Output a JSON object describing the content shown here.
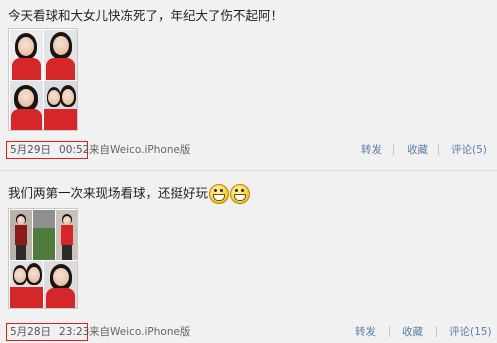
{
  "posts": [
    {
      "text": "今天看球和大女儿快冻死了，年纪大了伤不起阿！",
      "date": "5月29日",
      "time": "00:52",
      "source": "来自Weico.iPhone版",
      "repost_label": "转发",
      "favorite_label": "收藏",
      "comment_label": "评论(5)"
    },
    {
      "text": "我们两第一次来现场看球，还挺好玩",
      "emoji": [
        "grin-emoji",
        "grin-emoji"
      ],
      "date": "5月28日",
      "time": "23:23",
      "source": "来自Weico.iPhone版",
      "repost_label": "转发",
      "favorite_label": "收藏",
      "comment_label": "评论(15)"
    }
  ],
  "colors": {
    "highlight_box": "#e02020",
    "link": "#5b7fa8",
    "background": "#f1f1f1",
    "shirt_red": "#d5272a"
  }
}
